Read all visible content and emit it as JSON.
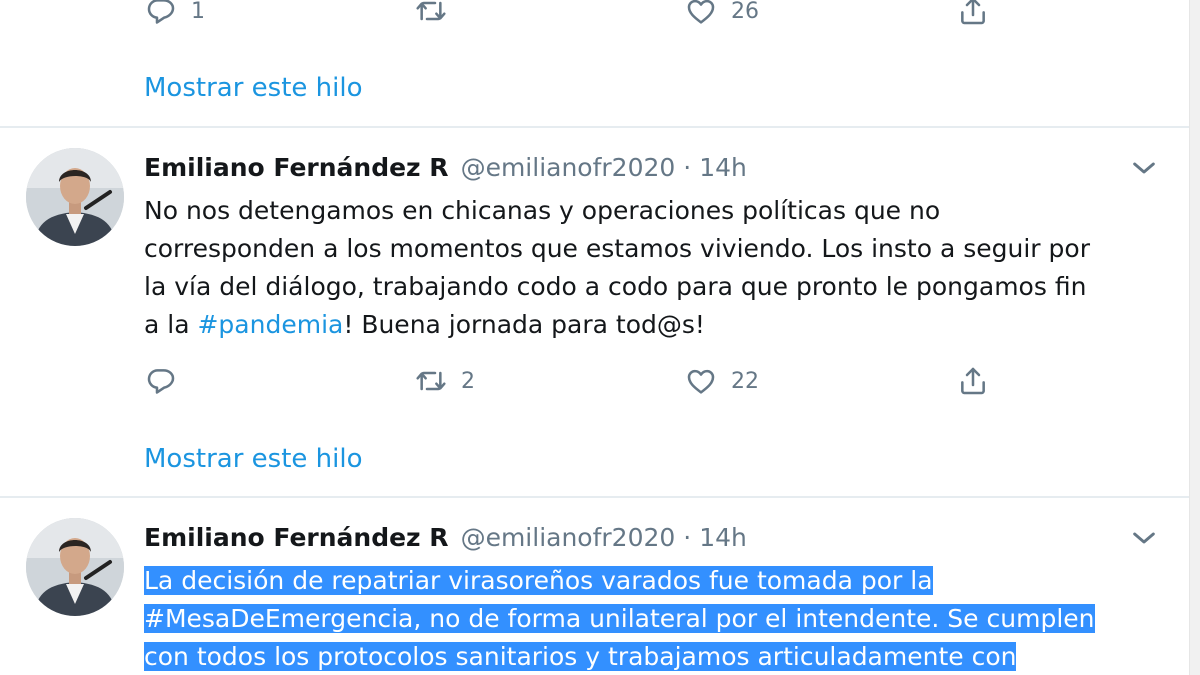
{
  "tweets": [
    {
      "actions": {
        "reply_count": "1",
        "retweet_count": "",
        "like_count": "26"
      },
      "show_thread": "Mostrar este hilo"
    },
    {
      "author": {
        "name": "Emiliano Fernández R",
        "handle": "@emilianofr2020",
        "separator": "·",
        "time": "14h"
      },
      "text": {
        "l1": "No nos detengamos en chicanas y operaciones políticas que no",
        "l2": "corresponden a los momentos que estamos viviendo. Los insto a seguir por",
        "l3": "la vía del diálogo, trabajando codo a codo para que pronto le pongamos fin",
        "l4_pre": "a la ",
        "l4_tag": "#pandemia",
        "l4_post": "! Buena jornada para tod@s!"
      },
      "actions": {
        "reply_count": "",
        "retweet_count": "2",
        "like_count": "22"
      },
      "show_thread": "Mostrar este hilo"
    },
    {
      "author": {
        "name": "Emiliano Fernández R",
        "handle": "@emilianofr2020",
        "separator": "·",
        "time": "14h"
      },
      "text": {
        "l1": "La decisión de repatriar virasoreños varados fue tomada por la",
        "l2": "#MesaDeEmergencia, no de forma unilateral por el intendente. Se cumplen",
        "l3": "con todos los protocolos sanitarios y trabajamos articuladamente con"
      },
      "selected": true
    }
  ],
  "icons": {
    "reply": "reply-icon",
    "retweet": "retweet-icon",
    "like": "heart-icon",
    "share": "share-icon",
    "more": "chevron-down-icon"
  },
  "colors": {
    "link": "#1b95e0",
    "muted": "#657786",
    "divider": "#e6ecf0",
    "selection": "#3390ff"
  }
}
